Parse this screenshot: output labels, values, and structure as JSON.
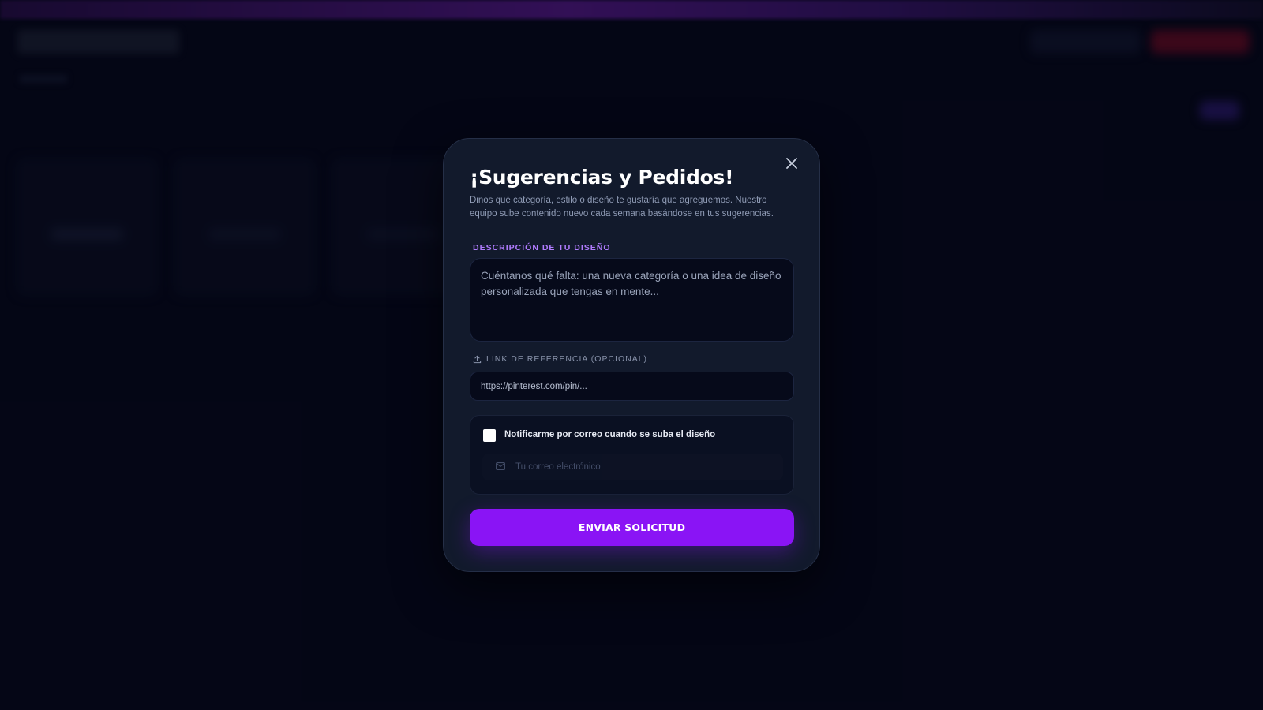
{
  "modal": {
    "title": "¡Sugerencias y Pedidos!",
    "description": "Dinos qué categoría, estilo o diseño te gustaría que agreguemos. Nuestro equipo sube contenido nuevo cada semana basándose en tus sugerencias.",
    "design_label": "DESCRIPCIÓN DE TU DISEÑO",
    "design_placeholder": "Cuéntanos qué falta: una nueva categoría o una idea de diseño personalizada que tengas en mente...",
    "design_value": "",
    "link_label": "LINK DE REFERENCIA (OPCIONAL)",
    "link_placeholder": "https://pinterest.com/pin/...",
    "link_value": "",
    "notify_label": "Notificarme por correo cuando se suba el diseño",
    "notify_checked": false,
    "email_placeholder": "Tu correo electrónico",
    "email_value": "",
    "submit_label": "ENVIAR SOLICITUD",
    "icons": {
      "close": "close-icon",
      "upload": "upload-icon",
      "email": "mail-icon"
    }
  },
  "colors": {
    "accent": "#8a14f5",
    "label_accent": "#b17cff",
    "modal_bg": "#121a2c",
    "page_bg": "#06081c"
  }
}
